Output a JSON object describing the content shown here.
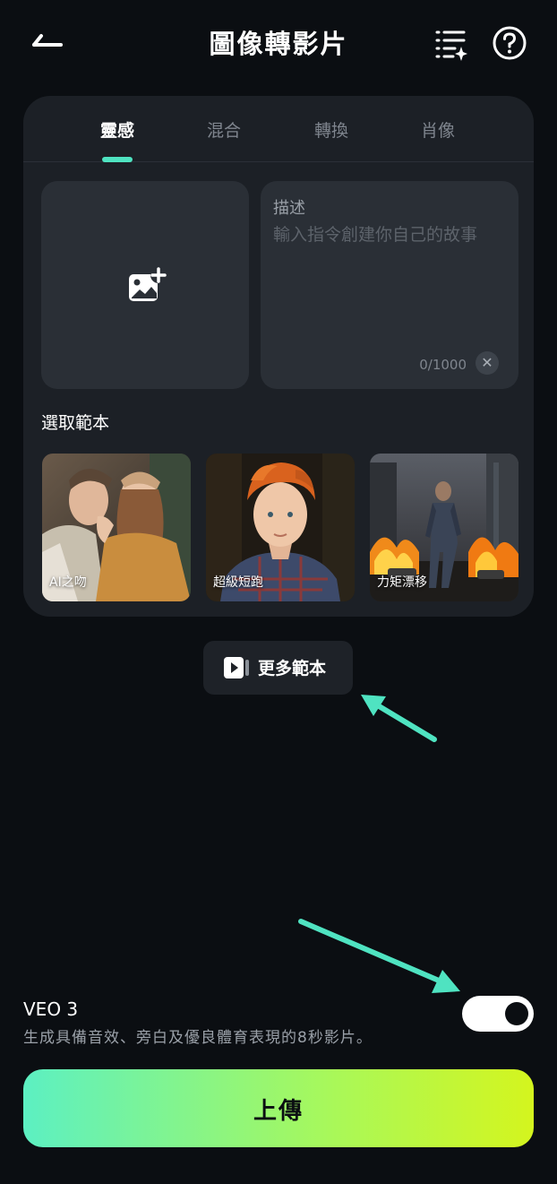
{
  "header": {
    "title": "圖像轉影片",
    "back_icon": "back-arrow-icon",
    "list_icon": "sparkle-list-icon",
    "help_icon": "help-circle-icon"
  },
  "tabs": [
    {
      "label": "靈感",
      "active": true
    },
    {
      "label": "混合",
      "active": false
    },
    {
      "label": "轉換",
      "active": false
    },
    {
      "label": "肖像",
      "active": false
    }
  ],
  "upload": {
    "icon": "add-image-icon"
  },
  "description": {
    "label": "描述",
    "placeholder": "輸入指令創建你自己的故事",
    "count": "0/1000"
  },
  "templates": {
    "label": "選取範本",
    "items": [
      {
        "label": "AI之吻"
      },
      {
        "label": "超級短跑"
      },
      {
        "label": "力矩漂移"
      }
    ]
  },
  "more_templates": {
    "label": "更多範本",
    "icon": "video-template-icon"
  },
  "veo": {
    "title": "VEO 3",
    "description": "生成具備音效、旁白及優良體育表現的8秒影片。",
    "enabled": true
  },
  "primary_action": {
    "label": "上傳"
  },
  "colors": {
    "background": "#0b0e12",
    "card": "#1c2026",
    "accent": "#4fe3c1",
    "annotation_arrow": "#4fe3c1",
    "button_gradient_start": "#5cf0c2",
    "button_gradient_end": "#d4f51e"
  }
}
